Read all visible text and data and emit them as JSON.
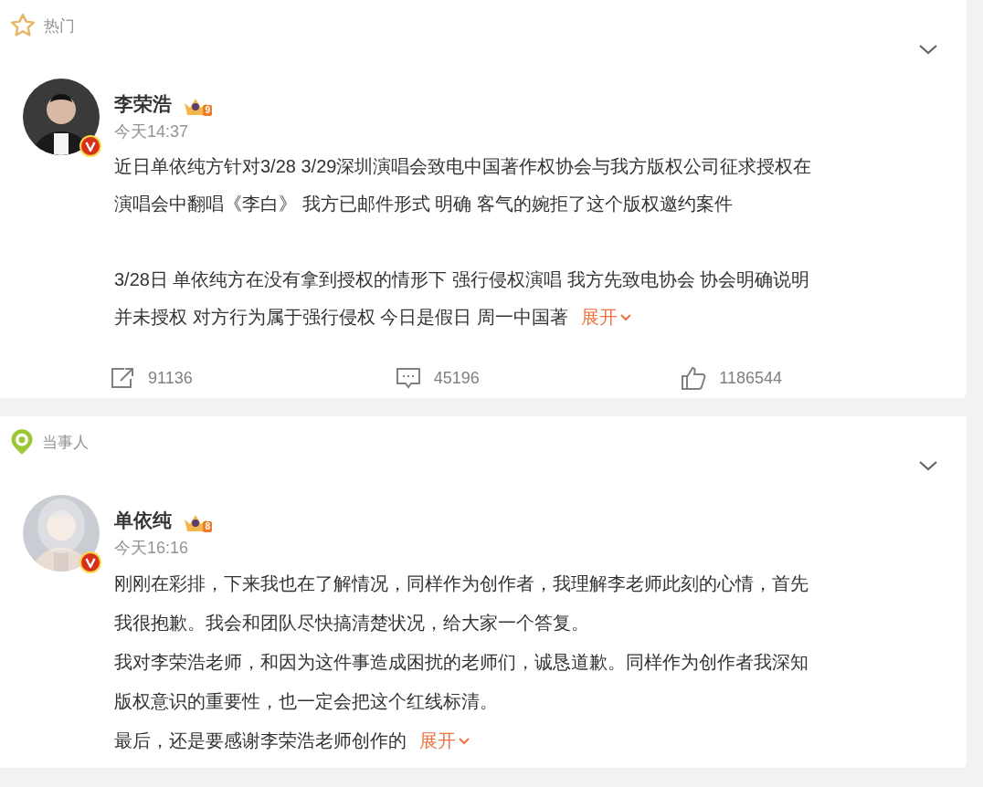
{
  "posts": [
    {
      "section": {
        "kind": "hot",
        "label": "热门"
      },
      "author": {
        "name": "李荣浩",
        "level_badge": "9",
        "verified": true
      },
      "time": "今天14:37",
      "paragraphs": [
        {
          "lines": [
            "近日单依纯方针对3/28 3/29深圳演唱会致电中国著作权协会与我方版权公司征求授权在",
            "演唱会中翻唱《李白》 我方已邮件形式 明确 客气的婉拒了这个版权邀约案件"
          ]
        },
        {
          "lines": [
            "3/28日 单依纯方在没有拿到授权的情形下 强行侵权演唱 我方先致电协会 协会明确说明",
            "并未授权 对方行为属于强行侵权 今日是假日 周一中国著"
          ]
        }
      ],
      "expand": "展开",
      "paragraph_gap": true,
      "actions": {
        "reposts": "91136",
        "comments": "45196",
        "likes": "1186544"
      }
    },
    {
      "section": {
        "kind": "party",
        "label": "当事人"
      },
      "author": {
        "name": "单依纯",
        "level_badge": "8",
        "verified": true
      },
      "time": "今天16:16",
      "paragraphs": [
        {
          "lines": [
            "刚刚在彩排，下来我也在了解情况，同样作为创作者，我理解李老师此刻的心情，首先",
            "我很抱歉。我会和团队尽快搞清楚状况，给大家一个答复。"
          ]
        },
        {
          "lines": [
            "我对李荣浩老师，和因为这件事造成困扰的老师们，诚恳道歉。同样作为创作者我深知",
            "版权意识的重要性，也一定会把这个红线标清。"
          ]
        },
        {
          "lines": [
            "最后，还是要感谢李荣浩老师创作的"
          ]
        }
      ],
      "expand": "展开",
      "paragraph_gap": false
    }
  ]
}
